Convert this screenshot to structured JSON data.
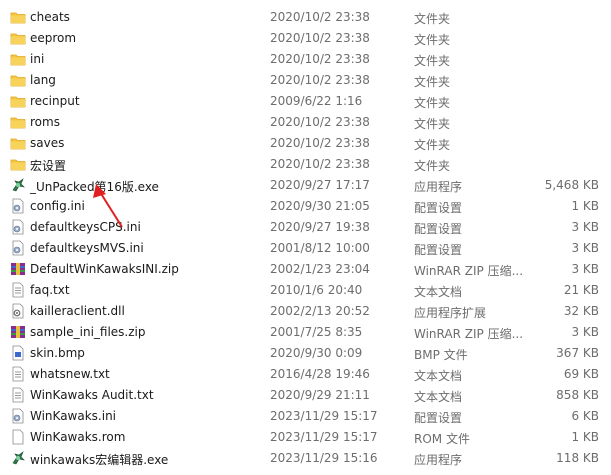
{
  "files": [
    {
      "name": "cheats",
      "date": "2020/10/2 23:38",
      "type": "文件夹",
      "size": "",
      "icon": "folder-icon"
    },
    {
      "name": "eeprom",
      "date": "2020/10/2 23:38",
      "type": "文件夹",
      "size": "",
      "icon": "folder-icon"
    },
    {
      "name": "ini",
      "date": "2020/10/2 23:38",
      "type": "文件夹",
      "size": "",
      "icon": "folder-icon"
    },
    {
      "name": "lang",
      "date": "2020/10/2 23:38",
      "type": "文件夹",
      "size": "",
      "icon": "folder-icon"
    },
    {
      "name": "recinput",
      "date": "2009/6/22 1:16",
      "type": "文件夹",
      "size": "",
      "icon": "folder-icon"
    },
    {
      "name": "roms",
      "date": "2020/10/2 23:38",
      "type": "文件夹",
      "size": "",
      "icon": "folder-icon"
    },
    {
      "name": "saves",
      "date": "2020/10/2 23:38",
      "type": "文件夹",
      "size": "",
      "icon": "folder-icon"
    },
    {
      "name": "宏设置",
      "date": "2020/10/2 23:38",
      "type": "文件夹",
      "size": "",
      "icon": "folder-icon"
    },
    {
      "name": "_UnPacked第16版.exe",
      "date": "2020/9/27 17:17",
      "type": "应用程序",
      "size": "5,468 KB",
      "icon": "app-icon"
    },
    {
      "name": "config.ini",
      "date": "2020/9/30 21:05",
      "type": "配置设置",
      "size": "1 KB",
      "icon": "settings-file-icon"
    },
    {
      "name": "defaultkeysCPS.ini",
      "date": "2020/9/27 19:38",
      "type": "配置设置",
      "size": "3 KB",
      "icon": "settings-file-icon"
    },
    {
      "name": "defaultkeysMVS.ini",
      "date": "2001/8/12 10:00",
      "type": "配置设置",
      "size": "3 KB",
      "icon": "settings-file-icon"
    },
    {
      "name": "DefaultWinKawaksINI.zip",
      "date": "2002/1/23 23:04",
      "type": "WinRAR ZIP 压缩...",
      "size": "3 KB",
      "icon": "archive-icon"
    },
    {
      "name": "faq.txt",
      "date": "2010/1/6 20:40",
      "type": "文本文档",
      "size": "21 KB",
      "icon": "text-file-icon"
    },
    {
      "name": "kailleraclient.dll",
      "date": "2002/2/13 20:52",
      "type": "应用程序扩展",
      "size": "32 KB",
      "icon": "dll-file-icon"
    },
    {
      "name": "sample_ini_files.zip",
      "date": "2001/7/25 8:35",
      "type": "WinRAR ZIP 压缩...",
      "size": "3 KB",
      "icon": "archive-icon"
    },
    {
      "name": "skin.bmp",
      "date": "2020/9/30 0:09",
      "type": "BMP 文件",
      "size": "367 KB",
      "icon": "image-file-icon"
    },
    {
      "name": "whatsnew.txt",
      "date": "2016/4/28 19:46",
      "type": "文本文档",
      "size": "69 KB",
      "icon": "text-file-icon"
    },
    {
      "name": "WinKawaks Audit.txt",
      "date": "2020/9/29 21:11",
      "type": "文本文档",
      "size": "858 KB",
      "icon": "text-file-icon"
    },
    {
      "name": "WinKawaks.ini",
      "date": "2023/11/29 15:17",
      "type": "配置设置",
      "size": "6 KB",
      "icon": "settings-file-icon"
    },
    {
      "name": "WinKawaks.rom",
      "date": "2023/11/29 15:17",
      "type": "ROM 文件",
      "size": "1 KB",
      "icon": "blank-file-icon"
    },
    {
      "name": "winkawaks宏编辑器.exe",
      "date": "2023/11/29 15:16",
      "type": "应用程序",
      "size": "118 KB",
      "icon": "app-icon"
    }
  ],
  "colors": {
    "folder": "#f5c642",
    "folder_dark": "#e0a820",
    "arrow": "#e02020",
    "archive": "#8b2b8b"
  }
}
